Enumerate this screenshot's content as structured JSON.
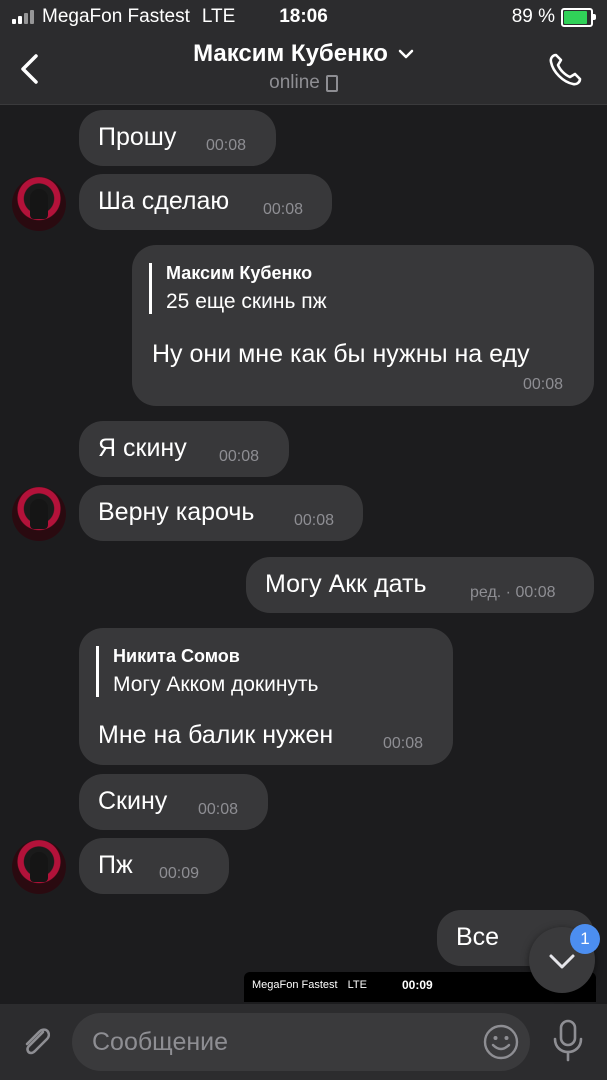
{
  "status_bar": {
    "carrier": "MegaFon Fastest",
    "network": "LTE",
    "time": "18:06",
    "battery": "89 %",
    "battery_level": 0.89
  },
  "header": {
    "title": "Максим Кубенко",
    "subtitle": "online"
  },
  "messages": [
    {
      "text": "Прошу",
      "time": "00:08"
    },
    {
      "text": "Ша сделаю",
      "time": "00:08"
    },
    {
      "reply_name": "Максим Кубенко",
      "reply_text": "25 еще скинь пж",
      "text": "Ну они мне как бы нужны на еду",
      "time": "00:08"
    },
    {
      "text": "Я скину",
      "time": "00:08"
    },
    {
      "text": "Верну карочь",
      "time": "00:08"
    },
    {
      "text": "Могу Акк дать",
      "time": "ред. · 00:08"
    },
    {
      "reply_name": "Никита Сомов",
      "reply_text": "Могу Акком докинуть",
      "text": "Мне на балик нужен",
      "time": "00:08"
    },
    {
      "text": "Скину",
      "time": "00:08"
    },
    {
      "text": "Пж",
      "time": "00:09"
    },
    {
      "text": "Все",
      "time": ""
    }
  ],
  "preview": {
    "carrier": "MegaFon Fastest",
    "network": "LTE",
    "time": "00:09"
  },
  "scroll_badge": "1",
  "input": {
    "placeholder": "Сообщение"
  },
  "colors": {
    "background": "#1c1c1e",
    "bubble": "#38383a",
    "bar": "#2c2c2e",
    "accent": "#4c8ef0",
    "battery": "#30d158"
  }
}
